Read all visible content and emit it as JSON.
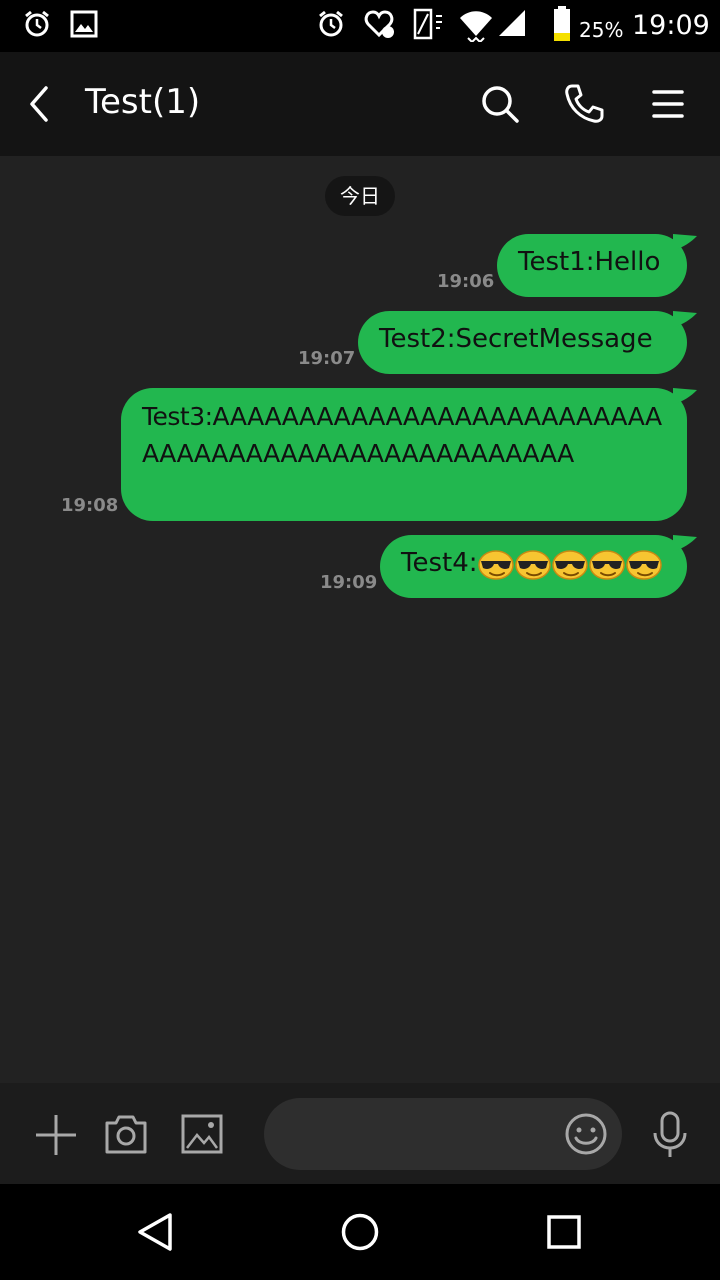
{
  "status_bar": {
    "battery_percent": "25%",
    "time": "19:09",
    "icons": [
      "alarm-icon",
      "image-icon",
      "alarm-icon",
      "heart-notification-icon",
      "rotate-icon",
      "wifi-icon",
      "signal-icon",
      "battery-icon"
    ]
  },
  "header": {
    "title": "Test(1)",
    "back_icon": "back-arrow-icon",
    "actions": [
      "search-icon",
      "phone-icon",
      "menu-icon"
    ]
  },
  "chat": {
    "date_label": "今日",
    "messages": [
      {
        "text": "Test1:Hello",
        "time": "19:06"
      },
      {
        "text": "Test2:SecretMessage",
        "time": "19:07"
      },
      {
        "text": "Test3:AAAAAAAAAAAAAAAAAAAAAAAAAAAAAAAAAAAAAAAAAAAAAAAAAAA",
        "time": "19:08"
      },
      {
        "text": "Test4:",
        "emoji": "cool-face-emoji",
        "emoji_count": 5,
        "time": "19:09"
      }
    ]
  },
  "input_bar": {
    "icons": [
      "plus-icon",
      "camera-icon",
      "gallery-icon",
      "emoji-icon",
      "mic-icon"
    ],
    "placeholder": ""
  },
  "nav_bar": {
    "icons": [
      "back-triangle-icon",
      "home-circle-icon",
      "recents-square-icon"
    ]
  },
  "colors": {
    "bubble": "#22b74f",
    "chat_bg": "#222222",
    "header_bg": "#141414",
    "timestamp": "#8a8a8a"
  }
}
